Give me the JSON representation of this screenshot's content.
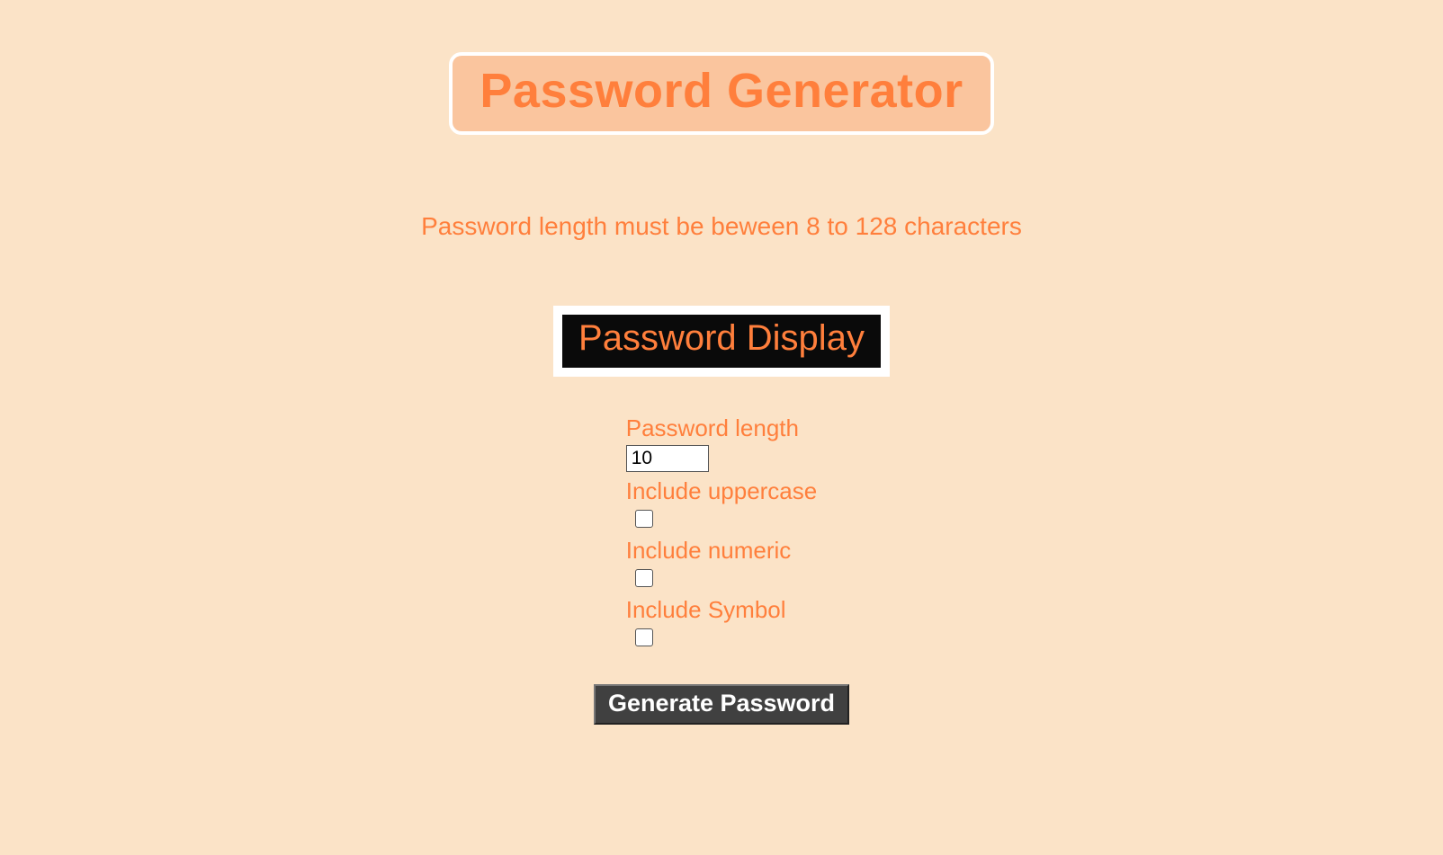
{
  "header": {
    "title": "Password Generator"
  },
  "subtitle": "Password length must be beween 8 to 128 characters",
  "display": {
    "label": "Password Display"
  },
  "form": {
    "length_label": "Password length",
    "length_value": "10",
    "uppercase_label": "Include uppercase",
    "numeric_label": "Include numeric",
    "symbol_label": "Include Symbol"
  },
  "button": {
    "generate_label": "Generate Password"
  }
}
